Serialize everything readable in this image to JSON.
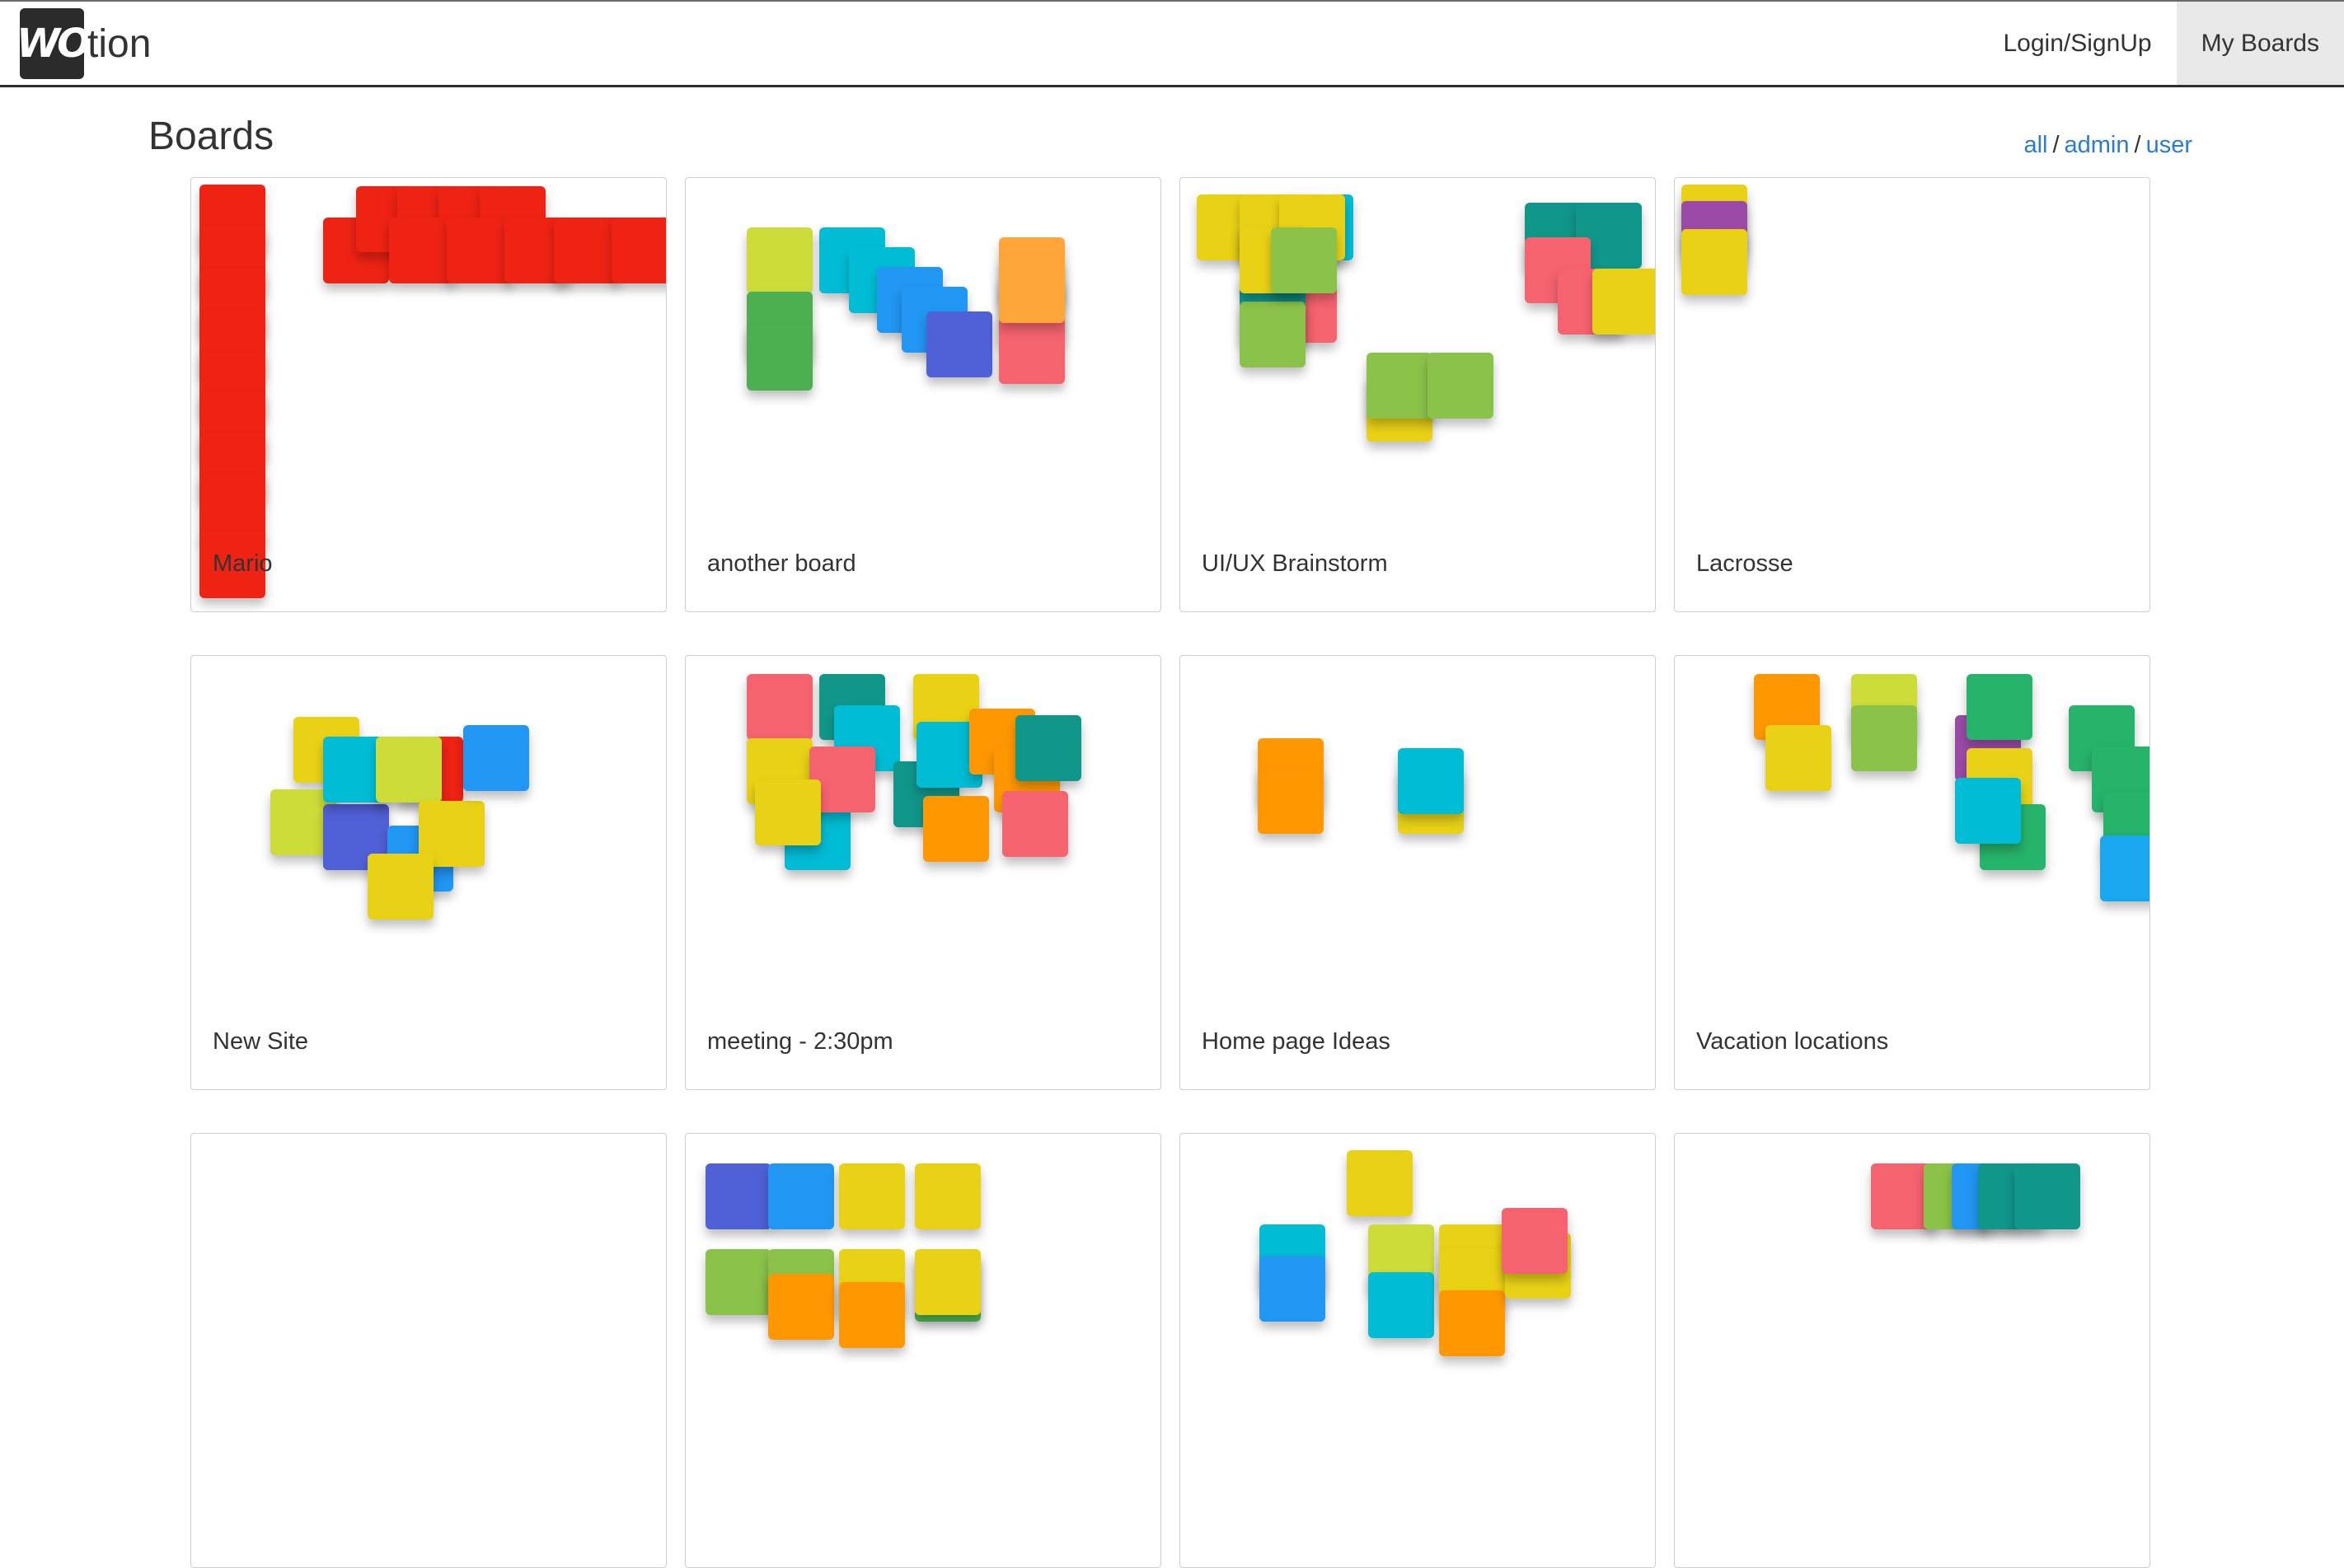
{
  "app": {
    "brand_mark": "WO",
    "brand_text": "tion"
  },
  "nav": {
    "login_label": "Login/SignUp",
    "my_boards_label": "My Boards"
  },
  "page": {
    "title": "Boards",
    "filters": {
      "all": "all",
      "admin": "admin",
      "user": "user",
      "separator": "/"
    }
  },
  "colors": {
    "red": "#ee2314",
    "lime": "#cddc39",
    "green": "#4caf50",
    "cyan": "#00bcd4",
    "blue": "#2196f3",
    "indigo": "#5060d6",
    "orange": "#ff9800",
    "amber": "#ffa63a",
    "pink": "#f5636f",
    "yellow": "#e9d216",
    "lightgreen": "#8bc34a",
    "teal": "#11968a",
    "emerald": "#26b36a",
    "purple": "#9c4aa8",
    "sky": "#19a8f0"
  },
  "boards": [
    {
      "name": "Mario"
    },
    {
      "name": "another board"
    },
    {
      "name": "UI/UX Brainstorm"
    },
    {
      "name": "Lacrosse"
    },
    {
      "name": "New Site"
    },
    {
      "name": "meeting - 2:30pm"
    },
    {
      "name": "Home page Ideas"
    },
    {
      "name": "Vacation locations"
    },
    {
      "name": ""
    },
    {
      "name": ""
    },
    {
      "name": ""
    },
    {
      "name": ""
    }
  ]
}
